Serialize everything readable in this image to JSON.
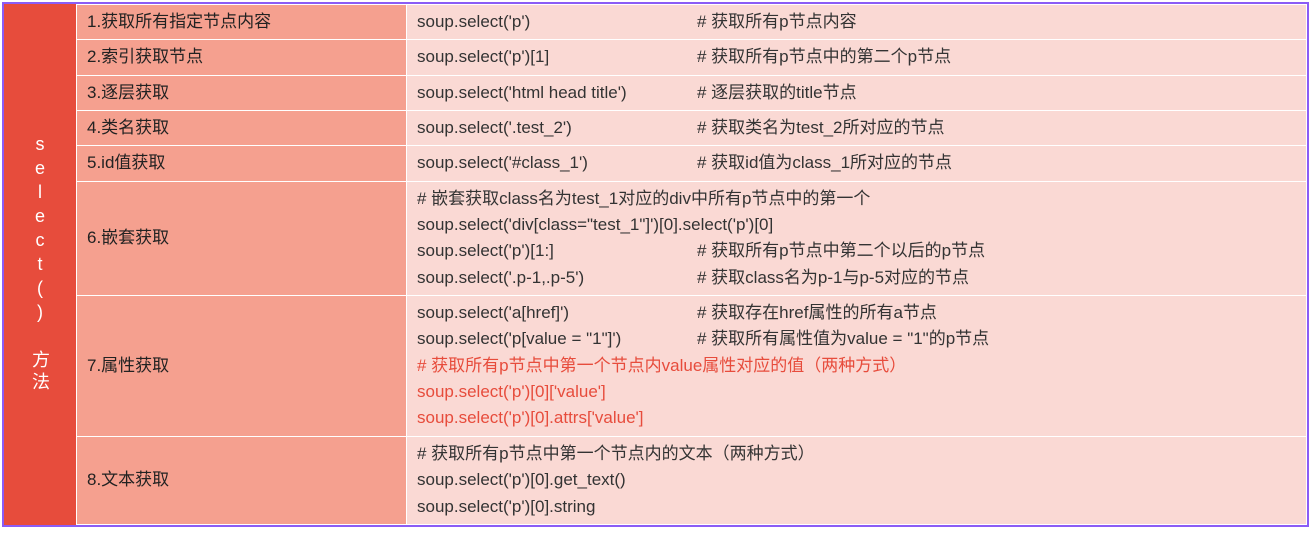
{
  "sidebar": {
    "title": "select() 方法"
  },
  "rows": [
    {
      "label": "1.获取所有指定节点内容",
      "lines": [
        {
          "code": "soup.select('p')",
          "comment": "# 获取所有p节点内容"
        }
      ]
    },
    {
      "label": "2.索引获取节点",
      "lines": [
        {
          "code": "soup.select('p')[1]",
          "comment": "# 获取所有p节点中的第二个p节点"
        }
      ]
    },
    {
      "label": "3.逐层获取",
      "lines": [
        {
          "code": "soup.select('html head title')",
          "comment": "# 逐层获取的title节点"
        }
      ]
    },
    {
      "label": "4.类名获取",
      "lines": [
        {
          "code": "soup.select('.test_2')",
          "comment": "# 获取类名为test_2所对应的节点"
        }
      ]
    },
    {
      "label": "5.id值获取",
      "lines": [
        {
          "code": "soup.select('#class_1')",
          "comment": "# 获取id值为class_1所对应的节点"
        }
      ]
    },
    {
      "label": "6.嵌套获取",
      "lines": [
        {
          "full": "# 嵌套获取class名为test_1对应的div中所有p节点中的第一个"
        },
        {
          "full": "soup.select('div[class=\"test_1\"]')[0].select('p')[0]"
        },
        {
          "code": "soup.select('p')[1:]",
          "comment": "# 获取所有p节点中第二个以后的p节点"
        },
        {
          "code": "soup.select('.p-1,.p-5')",
          "comment": "# 获取class名为p-1与p-5对应的节点"
        }
      ]
    },
    {
      "label": "7.属性获取",
      "lines": [
        {
          "code": "soup.select('a[href]')",
          "comment": "# 获取存在href属性的所有a节点"
        },
        {
          "code": "soup.select('p[value = \"1\"]')",
          "comment": "# 获取所有属性值为value = \"1\"的p节点"
        },
        {
          "full": "# 获取所有p节点中第一个节点内value属性对应的值（两种方式）",
          "red": true
        },
        {
          "full": "soup.select('p')[0]['value']",
          "red": true
        },
        {
          "full": "soup.select('p')[0].attrs['value']",
          "red": true
        }
      ]
    },
    {
      "label": "8.文本获取",
      "lines": [
        {
          "full": "# 获取所有p节点中第一个节点内的文本（两种方式）"
        },
        {
          "full": "soup.select('p')[0].get_text()"
        },
        {
          "full": "soup.select('p')[0].string"
        }
      ]
    }
  ]
}
